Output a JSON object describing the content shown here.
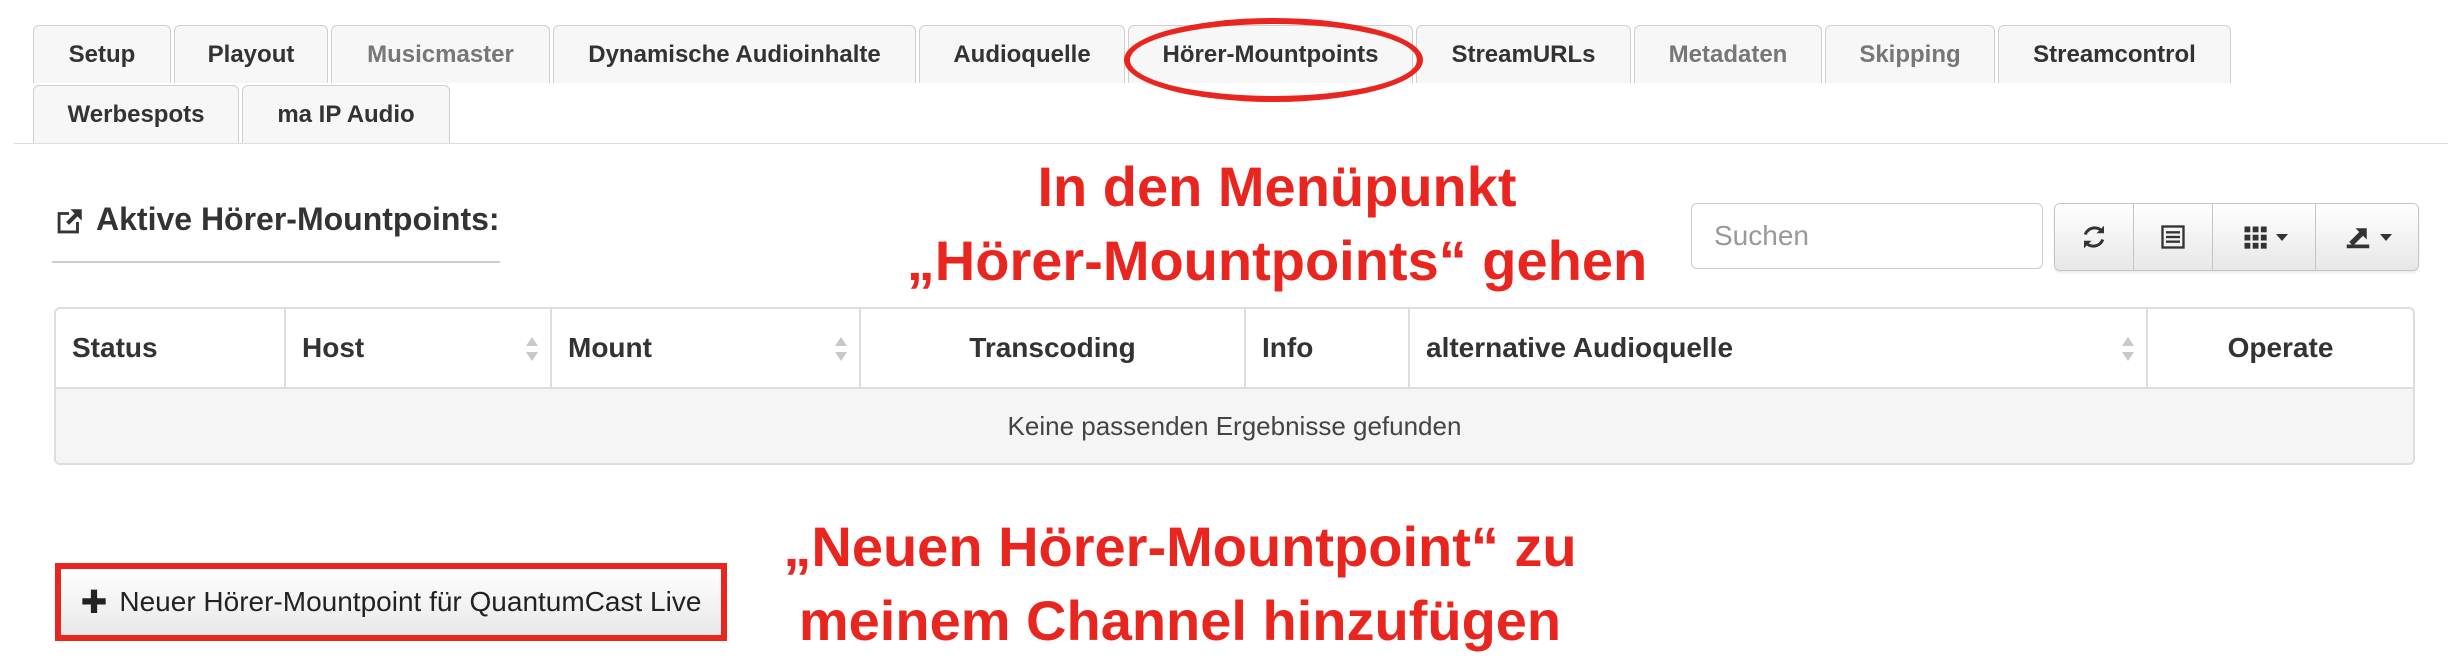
{
  "tabs_row1": [
    {
      "label": "Setup",
      "muted": false
    },
    {
      "label": "Playout",
      "muted": false
    },
    {
      "label": "Musicmaster",
      "muted": true
    },
    {
      "label": "Dynamische Audioinhalte",
      "muted": false
    },
    {
      "label": "Audioquelle",
      "muted": false
    },
    {
      "label": "Hörer-Mountpoints",
      "muted": false
    },
    {
      "label": "StreamURLs",
      "muted": false
    },
    {
      "label": "Metadaten",
      "muted": true
    },
    {
      "label": "Skipping",
      "muted": true
    },
    {
      "label": "Streamcontrol",
      "muted": false
    }
  ],
  "tabs_row2": [
    {
      "label": "Werbespots",
      "muted": false
    },
    {
      "label": "ma IP Audio",
      "muted": false
    }
  ],
  "section": {
    "title": "Aktive Hörer-Mountpoints:"
  },
  "search": {
    "placeholder": "Suchen",
    "value": ""
  },
  "toolbar": {
    "refresh_icon": "refresh-icon",
    "list_icon": "list-view-icon",
    "columns_icon": "columns-grid-icon",
    "export_icon": "export-icon"
  },
  "table": {
    "columns": [
      "Status",
      "Host",
      "Mount",
      "Transcoding",
      "Info",
      "alternative Audioquelle",
      "Operate"
    ],
    "empty_message": "Keine passenden Ergebnisse gefunden"
  },
  "add_button": {
    "label": "Neuer Hörer-Mountpoint für QuantumCast Live"
  },
  "annotations": {
    "top_line1": "In den Menüpunkt",
    "top_line2": "„Hörer-Mountpoints“ gehen",
    "bottom_line1": "„Neuen Hörer-Mountpoint“ zu",
    "bottom_line2": "meinem Channel hinzufügen"
  },
  "colors": {
    "annotation_red": "#e8261f",
    "border": "#dddddd"
  }
}
